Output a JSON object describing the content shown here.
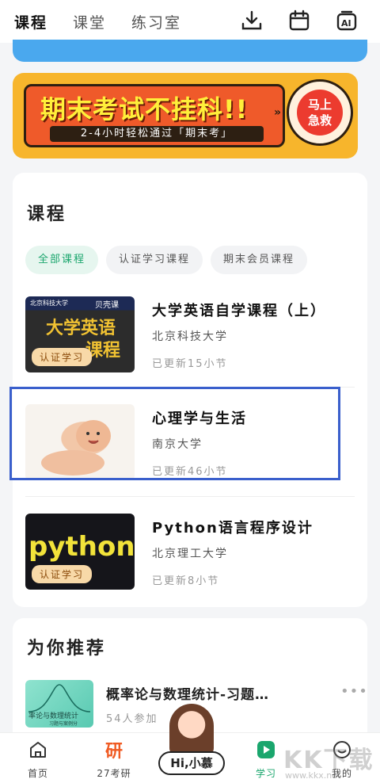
{
  "header": {
    "tabs": [
      "课程",
      "课堂",
      "练习室"
    ],
    "active_tab": "课程",
    "icons": [
      "download-icon",
      "calendar-icon",
      "ai-icon"
    ]
  },
  "banner": {
    "headline": "期末考试不挂科!!",
    "subline": "2-4小时轻松通过「期末考」",
    "button": [
      "马上",
      "急救"
    ]
  },
  "courses_section": {
    "title": "课程",
    "filters": [
      "全部课程",
      "认证学习课程",
      "期末会员课程"
    ],
    "active_filter": "全部课程",
    "items": [
      {
        "name": "大学英语自学课程（上）",
        "school": "北京科技大学",
        "update": "已更新15小节",
        "badge": "认证学习",
        "thumb_text": "大学英语",
        "thumb_text2": "课程",
        "thumb_brand": "北京科技大学",
        "thumb_logo": "贝壳课"
      },
      {
        "name": "心理学与生活",
        "school": "南京大学",
        "update": "已更新46小节",
        "badge": ""
      },
      {
        "name": "Python语言程序设计",
        "school": "北京理工大学",
        "update": "已更新8小节",
        "badge": "认证学习",
        "thumb_text": "python"
      }
    ]
  },
  "recommend": {
    "title": "为你推荐",
    "item": {
      "name": "概率论与数理统计-习题…",
      "count": "54人参加",
      "thumb_text": "率论与数理统计",
      "thumb_sub": "习题与案例分"
    }
  },
  "nav": {
    "items": [
      {
        "label": "首页",
        "icon": "home-icon"
      },
      {
        "label": "27考研",
        "icon": "yan-icon",
        "glyph": "研"
      },
      {
        "label": "学习",
        "icon": "play-icon"
      },
      {
        "label": "我的",
        "icon": "profile-icon"
      }
    ],
    "active": "学习",
    "hi_label": "Hi,小慕"
  },
  "watermark": {
    "big": "KK下载",
    "small": "www.kkx.net"
  },
  "colors": {
    "accent": "#1aa66d",
    "banner_bg": "#f7b52c",
    "banner_red": "#ef5a2a",
    "highlight": "#3a5fcc"
  }
}
